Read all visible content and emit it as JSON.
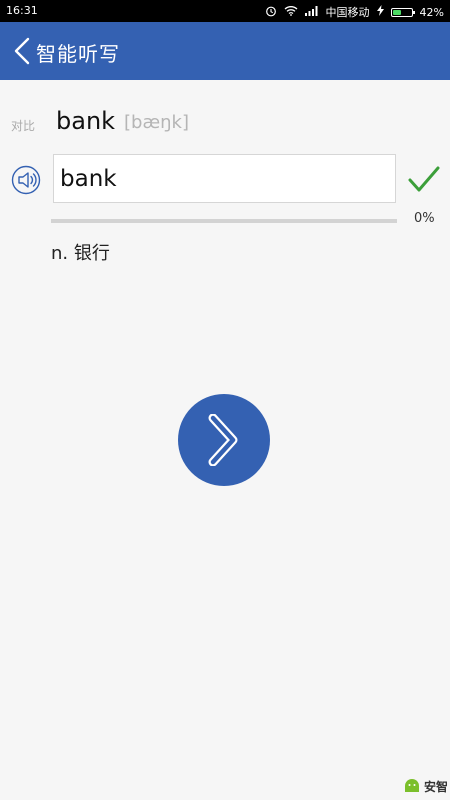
{
  "status_bar": {
    "time": "16:31",
    "carrier": "中国移动",
    "battery": "42%",
    "battery_level": 0.42
  },
  "app_bar": {
    "title": "智能听写",
    "back_icon": "chevron-left-icon"
  },
  "entry": {
    "compare_label": "对比",
    "word": "bank",
    "phonetic": "[bæŋk]",
    "answer_value": "bank",
    "answer_placeholder": "",
    "definition": "n. 银行",
    "progress_label": "0%",
    "progress_value": 0
  },
  "icons": {
    "speaker": "speaker-icon",
    "check": "check-icon",
    "next": "chevron-right-icon"
  },
  "colors": {
    "primary": "#3461b2",
    "check": "#3c9f3a"
  },
  "watermark": {
    "text": "安智"
  }
}
